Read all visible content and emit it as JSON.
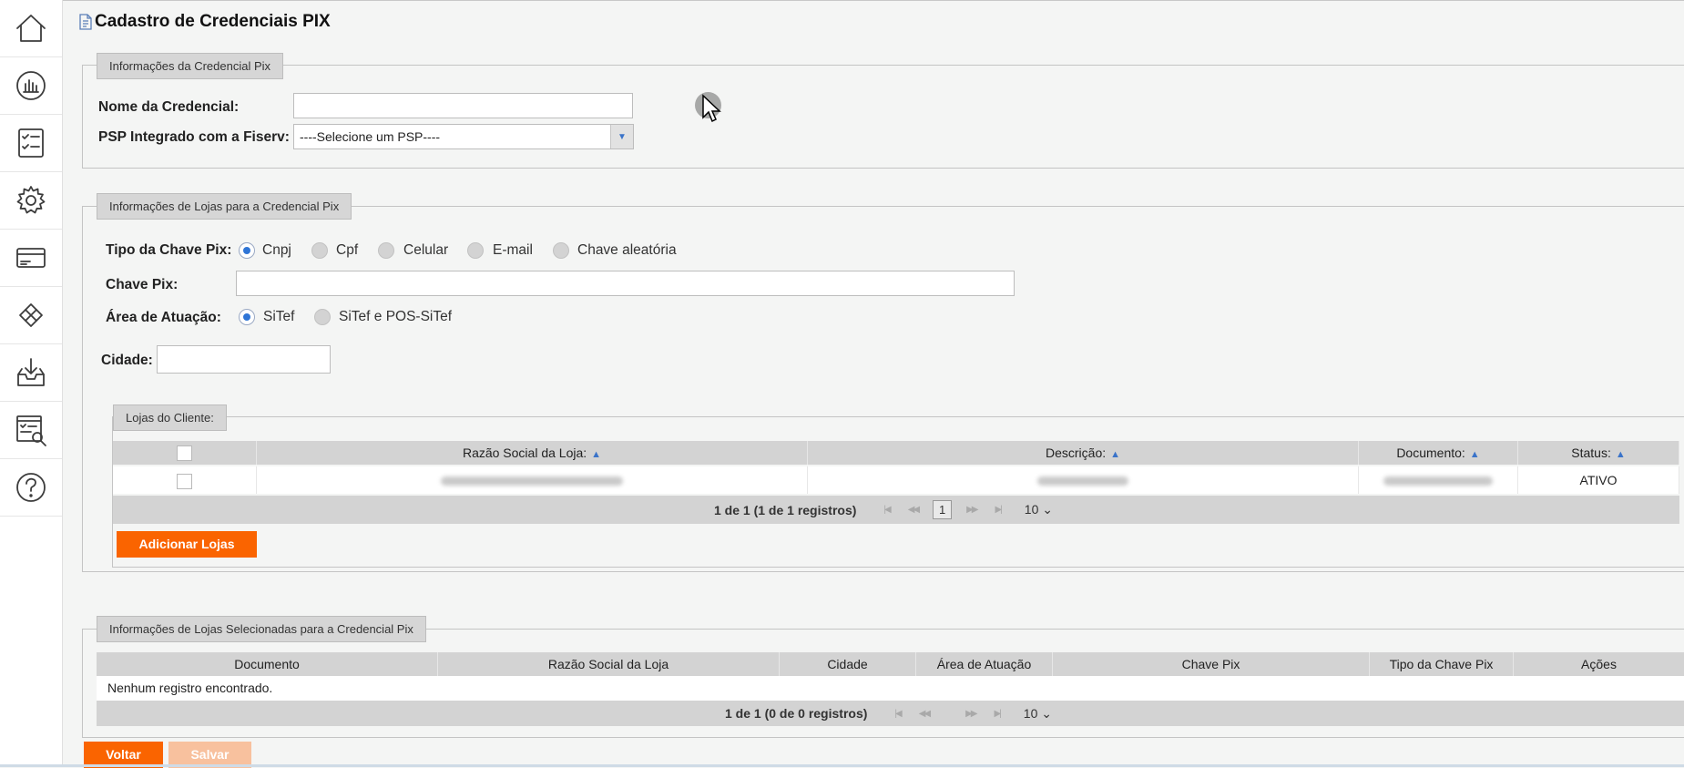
{
  "sidebar": {
    "items": [
      {
        "icon": "home-icon"
      },
      {
        "icon": "dashboard-chart-icon"
      },
      {
        "icon": "checklist-icon"
      },
      {
        "icon": "gear-icon"
      },
      {
        "icon": "card-icon"
      },
      {
        "icon": "diamond-icon"
      },
      {
        "icon": "inbox-download-icon"
      },
      {
        "icon": "report-search-icon"
      },
      {
        "icon": "help-icon"
      }
    ]
  },
  "page": {
    "title": "Cadastro de Credenciais PIX"
  },
  "credential_section": {
    "legend": "Informações da Credencial Pix",
    "name_label": "Nome da Credencial:",
    "name_value": "",
    "psp_label": "PSP Integrado com a Fiserv:",
    "psp_selected": "----Selecione um PSP----"
  },
  "stores_section": {
    "legend": "Informações de Lojas para a Credencial Pix",
    "key_type_label": "Tipo da Chave Pix:",
    "key_types": [
      "Cnpj",
      "Cpf",
      "Celular",
      "E-mail",
      "Chave aleatória"
    ],
    "key_type_selected": "Cnpj",
    "key_label": "Chave Pix:",
    "key_value": "",
    "area_label": "Área de Atuação:",
    "areas": [
      "SiTef",
      "SiTef e POS-SiTef"
    ],
    "area_selected": "SiTef",
    "city_label": "Cidade:",
    "city_value": ""
  },
  "client_stores": {
    "legend": "Lojas do Cliente:",
    "columns": [
      "Razão Social da Loja:",
      "Descrição:",
      "Documento:",
      "Status:"
    ],
    "rows": [
      {
        "razao": "",
        "descricao": "",
        "documento": "",
        "status": "ATIVO"
      }
    ],
    "pager_info": "1 de 1 (1 de 1 registros)",
    "page": "1",
    "page_size": "10",
    "add_button": "Adicionar Lojas"
  },
  "selected_stores": {
    "legend": "Informações de Lojas Selecionadas para a Credencial Pix",
    "columns": [
      "Documento",
      "Razão Social da Loja",
      "Cidade",
      "Área de Atuação",
      "Chave Pix",
      "Tipo da Chave Pix",
      "Ações"
    ],
    "empty_message": "Nenhum registro encontrado.",
    "pager_info": "1 de 1 (0 de 0 registros)",
    "page_size": "10"
  },
  "actions": {
    "back": "Voltar",
    "save": "Salvar"
  },
  "colors": {
    "accent": "#fa6400",
    "accent_disabled": "#f8c19e",
    "radio_selected": "#2f75d6"
  }
}
